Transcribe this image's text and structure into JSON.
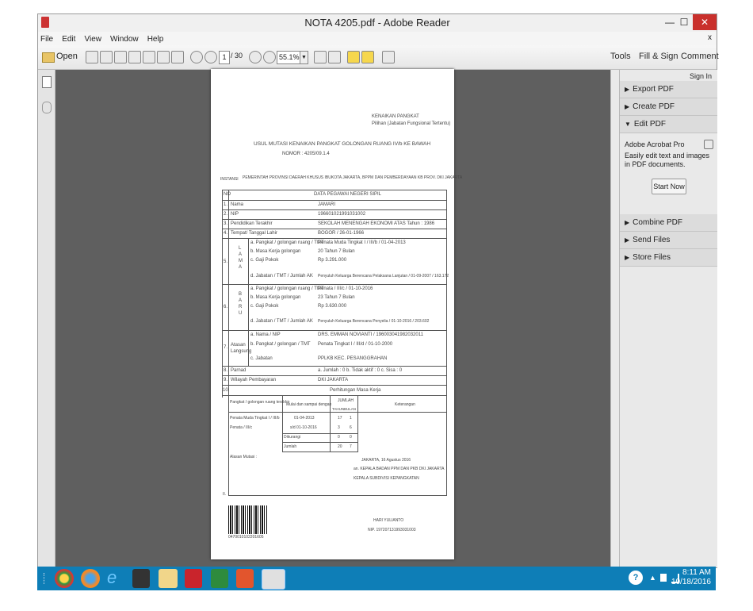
{
  "window": {
    "title": "NOTA 4205.pdf - Adobe Reader",
    "minimize": "—",
    "maximize": "☐",
    "close": "✕",
    "small_close": "x"
  },
  "menu": [
    "File",
    "Edit",
    "View",
    "Window",
    "Help"
  ],
  "toolbar": {
    "open_label": "Open",
    "page_current": "1",
    "page_total": "/ 30",
    "zoom": "55.1%",
    "tools": "Tools",
    "fill_sign": "Fill & Sign",
    "comment": "Comment"
  },
  "right_panel": {
    "sign_in": "Sign In",
    "sections": [
      "Export PDF",
      "Create PDF",
      "Edit PDF"
    ],
    "edit_title": "Adobe Acrobat Pro",
    "edit_desc": "Easily edit text and images in PDF documents.",
    "start_now": "Start Now",
    "sections2": [
      "Combine PDF",
      "Send Files",
      "Store Files"
    ]
  },
  "document": {
    "header_right1": "KENAIKAN PANGKAT",
    "header_right2": "Pilihan (Jabatan Fungsional Tertentu)",
    "title1": "USUL MUTASI KENAIKAN PANGKAT GOLONGAN RUANG IV/b KE BAWAH",
    "title2": "NOMOR : 4205/09.1.4",
    "instansi_label": "INSTANSI",
    "instansi": "PEMERINTAH PROVINSI DAERAH KHUSUS IBUKOTA JAKARTA, BPPM DAN PEMBERDAYAAN KB PROV. DKI JAKARTA",
    "rows": [
      {
        "no": "NO",
        "label": "",
        "value": "DATA PEGAWAI NEGERI SIPIL"
      },
      {
        "no": "1.",
        "label": "Nama",
        "value": "JAMARI"
      },
      {
        "no": "2.",
        "label": "NIP",
        "value": "196601021991031002"
      },
      {
        "no": "3.",
        "label": "Pendidikan Terakhir",
        "value": "SEKOLAH MENENGAH EKONOMI ATAS    Tahun : 1986"
      },
      {
        "no": "4.",
        "label": "Tempat/ Tanggal Lahir",
        "value": "BOGOR / 26-01-1966"
      }
    ],
    "lama_label": "LAMA",
    "lama": [
      {
        "label": "a. Pangkat / golongan ruang / TMT",
        "value": "Penata Muda Tingkat I / III/b / 01-04-2013"
      },
      {
        "label": "b. Masa Kerja golongan",
        "value": "20 Tahun 7 Bulan"
      },
      {
        "label": "c. Gaji Pokok",
        "value": "Rp 3.291.000"
      },
      {
        "label": "d. Jabatan / TMT / Jumlah AK",
        "value": "Penyuluh Keluarga Berencana Pelaksana Lanjutan / 01-09-2007 / 163.172"
      }
    ],
    "baru_label": "BARU",
    "baru": [
      {
        "label": "a. Pangkat / golongan ruang / TMT",
        "value": "Penata / III/c / 01-10-2016"
      },
      {
        "label": "b. Masa Kerja golongan",
        "value": "23 Tahun 7 Bulan"
      },
      {
        "label": "c. Gaji Pokok",
        "value": "Rp 3.630.000"
      },
      {
        "label": "d. Jabatan / TMT / Jumlah AK",
        "value": "Penyuluh Keluarga Berencana Penyelia / 01-10-2016 / 203.602"
      }
    ],
    "atasan_label": "Atasan Langsung",
    "atasan": [
      {
        "label": "a. Nama / NIP",
        "value": "DRS. EMMAN NOVIANTI / 196003041982032011"
      },
      {
        "label": "b. Pangkat / golongan / TMT",
        "value": "Penata Tingkat I / III/d / 01-10-2000"
      },
      {
        "label": "c. Jabatan",
        "value": "PPLKB KEC. PESANGGRAHAN"
      }
    ],
    "row8_label": "Parnad",
    "row8_value": "a. Jumlah : 0     b. Tidak aktif : 0     c. Sisa : 0",
    "row9_label": "Wilayah Pembayaran",
    "row9_value": "DKI JAKARTA",
    "row10_value": "Perhitungan Masa Kerja",
    "mk_head": [
      "Pangkat / golongan ruang terakhir",
      "Mulai dan sampai dengan",
      "JUMLAH",
      "Keterangan"
    ],
    "mk_sub": [
      "TAHUN",
      "BULAN"
    ],
    "mk_rows": [
      {
        "a": "Penata Muda Tingkat I / III/b",
        "b": "01-04-2013",
        "t": "17",
        "m": "1"
      },
      {
        "a": "Penata / III/c",
        "b": "s/d 01-10-2016",
        "t": "3",
        "m": "6"
      },
      {
        "a": "",
        "b": "Dikurangi",
        "t": "0",
        "m": "0"
      },
      {
        "a": "",
        "b": "Jumlah",
        "t": "20",
        "m": "7"
      }
    ],
    "alasan": "Alasan Mutasi :",
    "ttd1": "JAKARTA, 16 Agustus 2016",
    "ttd2": "an. KEPALA BADAN PPM DAN PKB DKI JAKARTA",
    "ttd3": "KEPALA SUBDIVISI KEPANGKATAN",
    "ttd_name": "HARI YULIANTO",
    "ttd_nip": "NIP. 197207131993031003",
    "roman": "II.",
    "barcode_text": "0470010102201605"
  },
  "taskbar": {
    "time": "8:11 AM",
    "date": "10/18/2016"
  }
}
